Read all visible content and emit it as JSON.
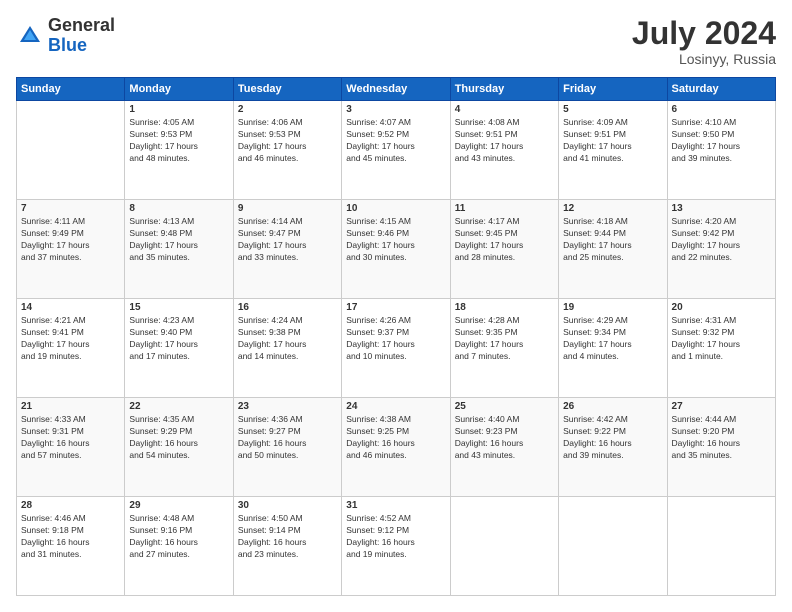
{
  "header": {
    "logo_general": "General",
    "logo_blue": "Blue",
    "month_year": "July 2024",
    "location": "Losinyy, Russia"
  },
  "calendar": {
    "days_of_week": [
      "Sunday",
      "Monday",
      "Tuesday",
      "Wednesday",
      "Thursday",
      "Friday",
      "Saturday"
    ],
    "weeks": [
      [
        {
          "day": "",
          "info": ""
        },
        {
          "day": "1",
          "info": "Sunrise: 4:05 AM\nSunset: 9:53 PM\nDaylight: 17 hours\nand 48 minutes."
        },
        {
          "day": "2",
          "info": "Sunrise: 4:06 AM\nSunset: 9:53 PM\nDaylight: 17 hours\nand 46 minutes."
        },
        {
          "day": "3",
          "info": "Sunrise: 4:07 AM\nSunset: 9:52 PM\nDaylight: 17 hours\nand 45 minutes."
        },
        {
          "day": "4",
          "info": "Sunrise: 4:08 AM\nSunset: 9:51 PM\nDaylight: 17 hours\nand 43 minutes."
        },
        {
          "day": "5",
          "info": "Sunrise: 4:09 AM\nSunset: 9:51 PM\nDaylight: 17 hours\nand 41 minutes."
        },
        {
          "day": "6",
          "info": "Sunrise: 4:10 AM\nSunset: 9:50 PM\nDaylight: 17 hours\nand 39 minutes."
        }
      ],
      [
        {
          "day": "7",
          "info": "Sunrise: 4:11 AM\nSunset: 9:49 PM\nDaylight: 17 hours\nand 37 minutes."
        },
        {
          "day": "8",
          "info": "Sunrise: 4:13 AM\nSunset: 9:48 PM\nDaylight: 17 hours\nand 35 minutes."
        },
        {
          "day": "9",
          "info": "Sunrise: 4:14 AM\nSunset: 9:47 PM\nDaylight: 17 hours\nand 33 minutes."
        },
        {
          "day": "10",
          "info": "Sunrise: 4:15 AM\nSunset: 9:46 PM\nDaylight: 17 hours\nand 30 minutes."
        },
        {
          "day": "11",
          "info": "Sunrise: 4:17 AM\nSunset: 9:45 PM\nDaylight: 17 hours\nand 28 minutes."
        },
        {
          "day": "12",
          "info": "Sunrise: 4:18 AM\nSunset: 9:44 PM\nDaylight: 17 hours\nand 25 minutes."
        },
        {
          "day": "13",
          "info": "Sunrise: 4:20 AM\nSunset: 9:42 PM\nDaylight: 17 hours\nand 22 minutes."
        }
      ],
      [
        {
          "day": "14",
          "info": "Sunrise: 4:21 AM\nSunset: 9:41 PM\nDaylight: 17 hours\nand 19 minutes."
        },
        {
          "day": "15",
          "info": "Sunrise: 4:23 AM\nSunset: 9:40 PM\nDaylight: 17 hours\nand 17 minutes."
        },
        {
          "day": "16",
          "info": "Sunrise: 4:24 AM\nSunset: 9:38 PM\nDaylight: 17 hours\nand 14 minutes."
        },
        {
          "day": "17",
          "info": "Sunrise: 4:26 AM\nSunset: 9:37 PM\nDaylight: 17 hours\nand 10 minutes."
        },
        {
          "day": "18",
          "info": "Sunrise: 4:28 AM\nSunset: 9:35 PM\nDaylight: 17 hours\nand 7 minutes."
        },
        {
          "day": "19",
          "info": "Sunrise: 4:29 AM\nSunset: 9:34 PM\nDaylight: 17 hours\nand 4 minutes."
        },
        {
          "day": "20",
          "info": "Sunrise: 4:31 AM\nSunset: 9:32 PM\nDaylight: 17 hours\nand 1 minute."
        }
      ],
      [
        {
          "day": "21",
          "info": "Sunrise: 4:33 AM\nSunset: 9:31 PM\nDaylight: 16 hours\nand 57 minutes."
        },
        {
          "day": "22",
          "info": "Sunrise: 4:35 AM\nSunset: 9:29 PM\nDaylight: 16 hours\nand 54 minutes."
        },
        {
          "day": "23",
          "info": "Sunrise: 4:36 AM\nSunset: 9:27 PM\nDaylight: 16 hours\nand 50 minutes."
        },
        {
          "day": "24",
          "info": "Sunrise: 4:38 AM\nSunset: 9:25 PM\nDaylight: 16 hours\nand 46 minutes."
        },
        {
          "day": "25",
          "info": "Sunrise: 4:40 AM\nSunset: 9:23 PM\nDaylight: 16 hours\nand 43 minutes."
        },
        {
          "day": "26",
          "info": "Sunrise: 4:42 AM\nSunset: 9:22 PM\nDaylight: 16 hours\nand 39 minutes."
        },
        {
          "day": "27",
          "info": "Sunrise: 4:44 AM\nSunset: 9:20 PM\nDaylight: 16 hours\nand 35 minutes."
        }
      ],
      [
        {
          "day": "28",
          "info": "Sunrise: 4:46 AM\nSunset: 9:18 PM\nDaylight: 16 hours\nand 31 minutes."
        },
        {
          "day": "29",
          "info": "Sunrise: 4:48 AM\nSunset: 9:16 PM\nDaylight: 16 hours\nand 27 minutes."
        },
        {
          "day": "30",
          "info": "Sunrise: 4:50 AM\nSunset: 9:14 PM\nDaylight: 16 hours\nand 23 minutes."
        },
        {
          "day": "31",
          "info": "Sunrise: 4:52 AM\nSunset: 9:12 PM\nDaylight: 16 hours\nand 19 minutes."
        },
        {
          "day": "",
          "info": ""
        },
        {
          "day": "",
          "info": ""
        },
        {
          "day": "",
          "info": ""
        }
      ]
    ]
  }
}
